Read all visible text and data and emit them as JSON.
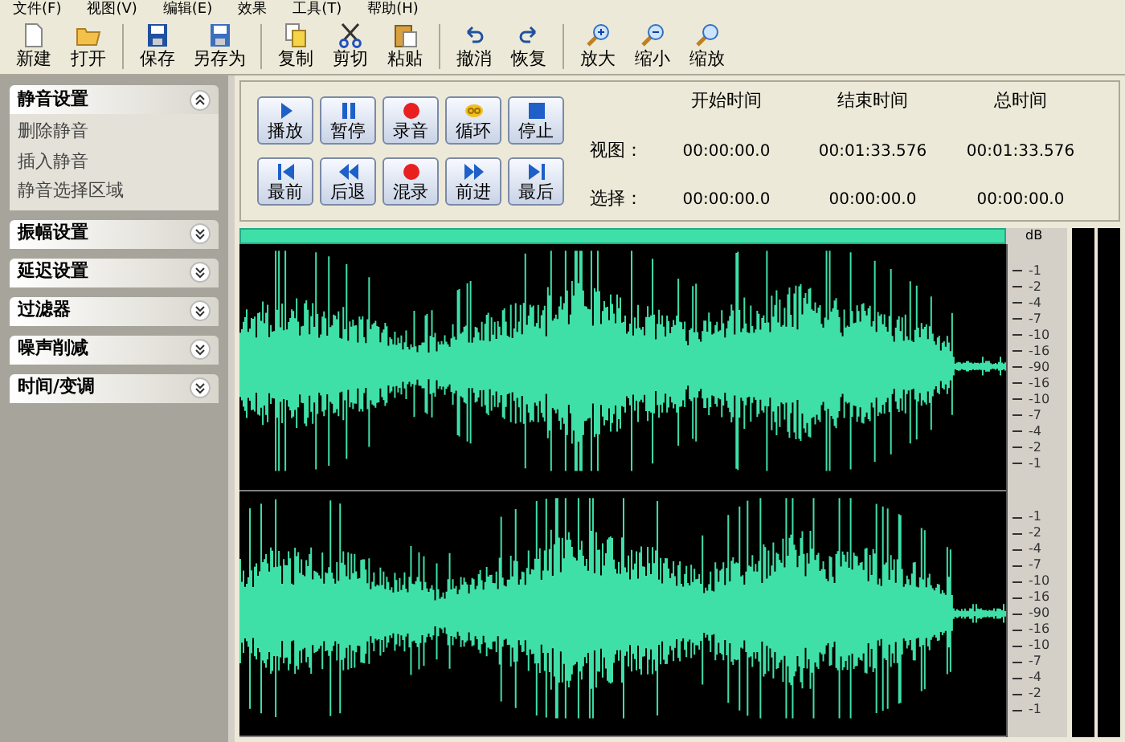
{
  "menu": [
    "文件(F)",
    "视图(V)",
    "编辑(E)",
    "效果",
    "工具(T)",
    "帮助(H)"
  ],
  "toolbar": [
    [
      {
        "label": "新建",
        "kind": "new"
      },
      {
        "label": "打开",
        "kind": "open"
      }
    ],
    [
      {
        "label": "保存",
        "kind": "save"
      },
      {
        "label": "另存为",
        "kind": "saveas"
      }
    ],
    [
      {
        "label": "复制",
        "kind": "copy"
      },
      {
        "label": "剪切",
        "kind": "cut"
      },
      {
        "label": "粘贴",
        "kind": "paste"
      }
    ],
    [
      {
        "label": "撤消",
        "kind": "undo"
      },
      {
        "label": "恢复",
        "kind": "redo"
      }
    ],
    [
      {
        "label": "放大",
        "kind": "zoomin"
      },
      {
        "label": "缩小",
        "kind": "zoomout"
      },
      {
        "label": "缩放",
        "kind": "zoom"
      }
    ]
  ],
  "sidebar": [
    {
      "title": "静音设置",
      "expanded": true,
      "items": [
        "删除静音",
        "插入静音",
        "静音选择区域"
      ]
    },
    {
      "title": "振幅设置",
      "expanded": false
    },
    {
      "title": "延迟设置",
      "expanded": false
    },
    {
      "title": "过滤器",
      "expanded": false
    },
    {
      "title": "噪声削减",
      "expanded": false
    },
    {
      "title": "时间/变调",
      "expanded": false
    }
  ],
  "transport": [
    [
      {
        "label": "播放",
        "kind": "play"
      },
      {
        "label": "暂停",
        "kind": "pause"
      },
      {
        "label": "录音",
        "kind": "record"
      },
      {
        "label": "循环",
        "kind": "loop"
      },
      {
        "label": "停止",
        "kind": "stop"
      }
    ],
    [
      {
        "label": "最前",
        "kind": "first"
      },
      {
        "label": "后退",
        "kind": "rewind"
      },
      {
        "label": "混录",
        "kind": "record"
      },
      {
        "label": "前进",
        "kind": "forward"
      },
      {
        "label": "最后",
        "kind": "last"
      }
    ]
  ],
  "times": {
    "columns": [
      "开始时间",
      "结束时间",
      "总时间"
    ],
    "rows": [
      {
        "label": "视图：",
        "values": [
          "00:00:00.0",
          "00:01:33.576",
          "00:01:33.576"
        ]
      },
      {
        "label": "选择：",
        "values": [
          "00:00:00.0",
          "00:00:00.0",
          "00:00:00.0"
        ]
      }
    ]
  },
  "db_unit": "dB",
  "channels": [
    {
      "scale": [
        "-1",
        "-2",
        "-4",
        "-7",
        "-10",
        "-16",
        "-90",
        "-16",
        "-10",
        "-7",
        "-4",
        "-2",
        "-1"
      ]
    },
    {
      "scale": [
        "-1",
        "-2",
        "-4",
        "-7",
        "-10",
        "-16",
        "-90",
        "-16",
        "-10",
        "-7",
        "-4",
        "-2",
        "-1"
      ]
    }
  ]
}
